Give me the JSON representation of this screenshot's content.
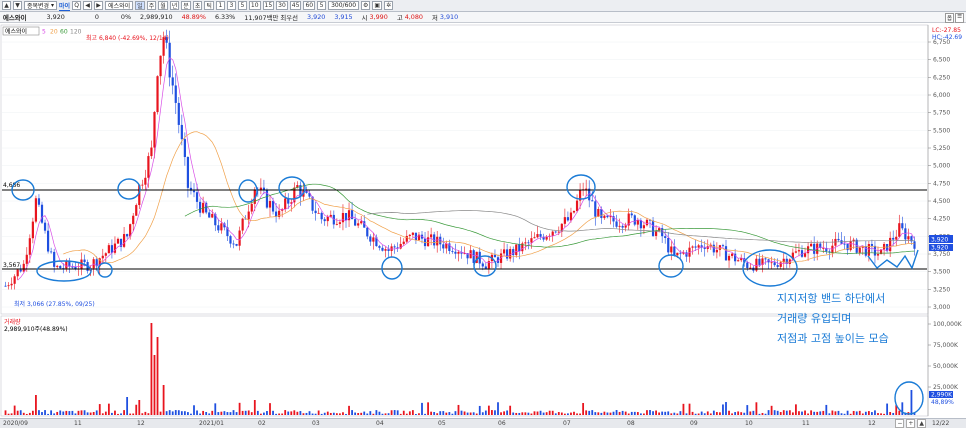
{
  "toolbar": {
    "buttons": [
      "▲",
      "▼"
    ],
    "combo_label": "종목변경",
    "active_tab": "마이",
    "glyph_search": "Q",
    "glyph_prev": "◀",
    "glyph_next": "▶",
    "stock_code": "에스와이",
    "periods": [
      "일",
      "주",
      "월",
      "년",
      "분",
      "초",
      "틱"
    ],
    "intervals": [
      "1",
      "3",
      "5",
      "10",
      "15",
      "30",
      "45",
      "60"
    ],
    "extra": "5",
    "count": "300",
    "count_total": "600"
  },
  "quote": {
    "name": "에스와이",
    "price": "3,920",
    "change": "0",
    "change_pct": "0%",
    "volume": "2,989,910",
    "volume_ratio": "48.89%",
    "turnover": "6.33%",
    "amount": "11,907백만",
    "best_sell_label": "최우선",
    "best_sell": "3,920",
    "bid": "3,915",
    "open_label": "시",
    "open": "3,990",
    "high_label": "고",
    "high": "4,080",
    "low_label": "저",
    "low": "3,910",
    "corner": [
      "옵",
      "☰"
    ]
  },
  "price_panel": {
    "legend_title": "에스와이",
    "ma_labels": [
      "5",
      "20",
      "60",
      "120"
    ],
    "max_label": "최고 6,840 (-42.69%, 12/14)",
    "min_label": "최저 3,066 (27.85%, 09/25)",
    "right_top_lc": "LC:-27.85",
    "right_top_hc": "HC:-42.69",
    "resistance_label": "4,686",
    "support_label": "3,567",
    "current_price_tag": "3,920",
    "current_price_tag2": "3,920",
    "y_ticks": [
      "6,750",
      "6,500",
      "6,250",
      "6,000",
      "5,750",
      "5,500",
      "5,250",
      "5,000",
      "4,750",
      "4,500",
      "4,250",
      "4,000",
      "3,750",
      "3,500",
      "3,250",
      "3,000"
    ]
  },
  "volume_panel": {
    "title": "거래량",
    "value": "2,989,910주(48.89%)",
    "y_ticks": [
      "100,000K",
      "75,000K",
      "50,000K",
      "25,000K"
    ],
    "tag": "2,990K",
    "tag2": "48,89%"
  },
  "annotation": {
    "lines": [
      "지지저항 밴드 하단에서",
      "거래량 유입되며",
      "저점과 고점 높이는 모습"
    ]
  },
  "x_axis": {
    "labels": [
      "2020/09",
      "11",
      "12",
      "2021/01",
      "02",
      "03",
      "04",
      "05",
      "06",
      "07",
      "08",
      "09",
      "10",
      "11",
      "12",
      "12/22"
    ]
  },
  "colors": {
    "up": "#e8141e",
    "down": "#1f4fe0",
    "ma5": "#d84de6",
    "ma20": "#f0a14a",
    "ma60": "#3a9a3a",
    "ma120": "#888888",
    "circle": "#1a7bd6"
  }
}
